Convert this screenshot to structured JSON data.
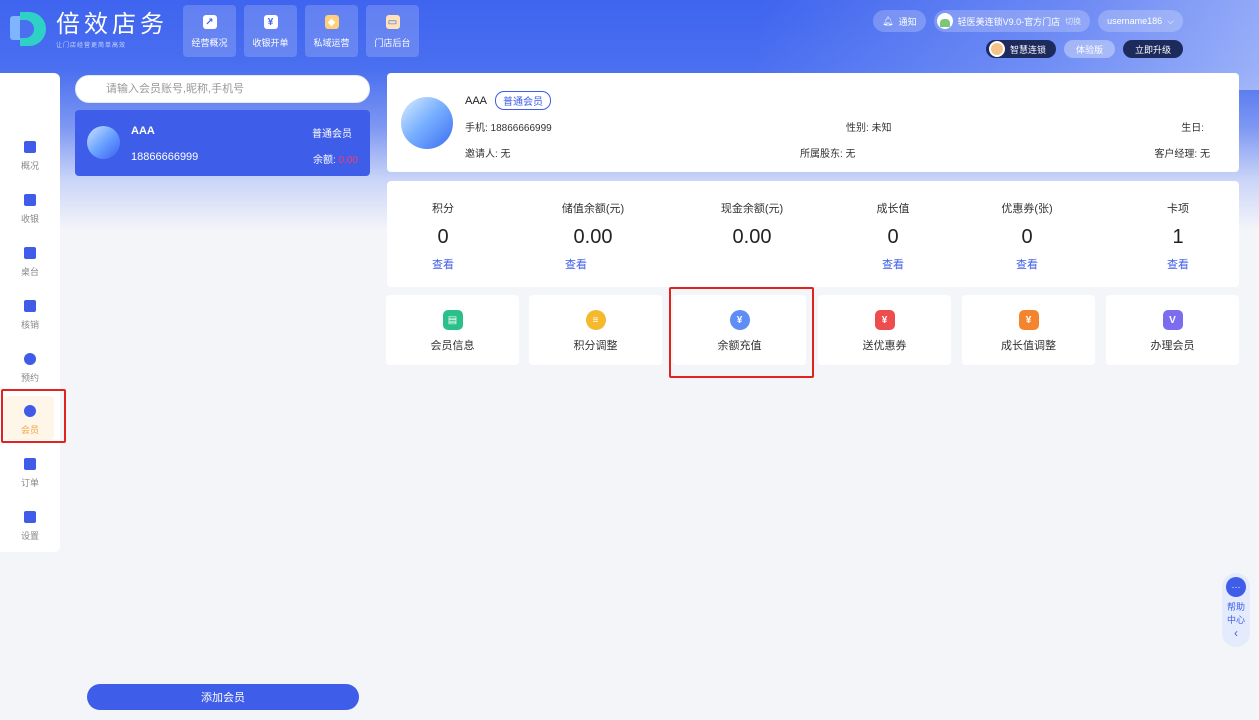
{
  "brand": {
    "title": "倍效店务",
    "subtitle": "让门店经营更简单高效"
  },
  "topnav": [
    {
      "label": "经营概况",
      "icon": "chart-icon"
    },
    {
      "label": "收银开单",
      "icon": "cashier-icon"
    },
    {
      "label": "私域运营",
      "icon": "diamond-icon"
    },
    {
      "label": "门店后台",
      "icon": "store-icon"
    }
  ],
  "header": {
    "notify_label": "通知",
    "store_label": "轻医美连锁V9.0-官方门店",
    "switch_label": "切换",
    "username": "username186",
    "plan_label": "智慧连锁",
    "trial_label": "体验版",
    "upgrade_label": "立即升级"
  },
  "sidebar": [
    {
      "label": "概况"
    },
    {
      "label": "收银"
    },
    {
      "label": "桌台"
    },
    {
      "label": "核销"
    },
    {
      "label": "预约"
    },
    {
      "label": "会员"
    },
    {
      "label": "订单"
    },
    {
      "label": "设置"
    }
  ],
  "search": {
    "placeholder": "请输入会员账号,昵称,手机号"
  },
  "member_list": [
    {
      "name": "AAA",
      "phone": "18866666999",
      "level": "普通会员",
      "balance_label": "余额:",
      "balance": "0.00"
    }
  ],
  "add_member_label": "添加会员",
  "profile": {
    "name": "AAA",
    "level": "普通会员",
    "phone": "手机: 18866666999",
    "gender": "性别: 未知",
    "birthday": "生日:",
    "inviter": "邀请人: 无",
    "shareholder": "所属股东: 无",
    "manager": "客户经理: 无"
  },
  "stats": [
    {
      "label": "积分",
      "value": "0",
      "link": "查看"
    },
    {
      "label": "储值余额(元)",
      "value": "0.00",
      "link": "查看"
    },
    {
      "label": "现金余额(元)",
      "value": "0.00",
      "link": ""
    },
    {
      "label": "成长值",
      "value": "0",
      "link": "查看"
    },
    {
      "label": "优惠券(张)",
      "value": "0",
      "link": "查看"
    },
    {
      "label": "卡项",
      "value": "1",
      "link": "查看"
    }
  ],
  "actions": [
    {
      "label": "会员信息",
      "icon": "member-info-icon",
      "color": "#2bbf8a"
    },
    {
      "label": "积分调整",
      "icon": "coins-icon",
      "color": "#f5b92e"
    },
    {
      "label": "余额充值",
      "icon": "recharge-icon",
      "color": "#5d8df5"
    },
    {
      "label": "送优惠券",
      "icon": "coupon-icon",
      "color": "#ee4d4d"
    },
    {
      "label": "成长值调整",
      "icon": "growth-icon",
      "color": "#f5842e"
    },
    {
      "label": "办理会员",
      "icon": "vip-icon",
      "color": "#7c6cf0"
    }
  ],
  "help": {
    "label": "帮助中心",
    "label1": "帮助",
    "label2": "中心",
    "arrow": "‹"
  }
}
